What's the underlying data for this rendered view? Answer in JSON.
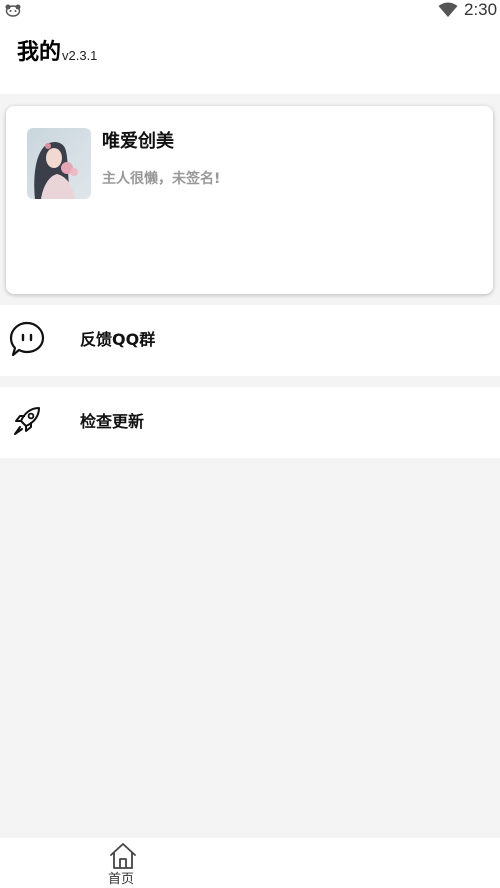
{
  "status_bar": {
    "time": "2:30",
    "app_icon": "panda-icon",
    "wifi_icon": "wifi-icon"
  },
  "header": {
    "title": "我的",
    "version": "v2.3.1"
  },
  "profile": {
    "name": "唯爱创美",
    "signature": "主人很懒，未签名!",
    "avatar": "avatar-photo"
  },
  "menu": [
    {
      "label": "反馈QQ群",
      "icon": "chat-bubble-icon"
    },
    {
      "label": "检查更新",
      "icon": "rocket-icon"
    }
  ],
  "bottom_nav": {
    "home_label": "首页",
    "home_icon": "home-icon"
  }
}
